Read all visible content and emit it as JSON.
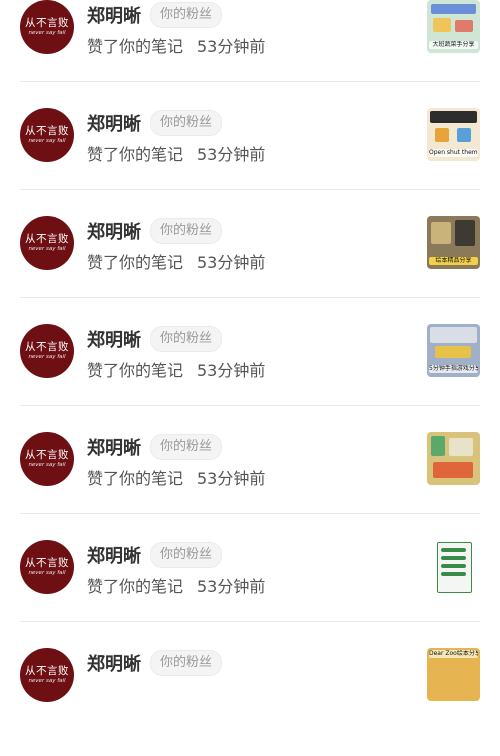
{
  "notifications": [
    {
      "avatar_line1": "从不言败",
      "avatar_line2": "never say fail",
      "name": "郑明晰",
      "badge": "你的粉丝",
      "action": "赞了你的笔记",
      "time": "53分钟前",
      "thumb_caption": "大班蔬菜手分享"
    },
    {
      "avatar_line1": "从不言败",
      "avatar_line2": "never say fail",
      "name": "郑明晰",
      "badge": "你的粉丝",
      "action": "赞了你的笔记",
      "time": "53分钟前",
      "thumb_caption": "Open shut them 绘本游戏分享"
    },
    {
      "avatar_line1": "从不言败",
      "avatar_line2": "never say fail",
      "name": "郑明晰",
      "badge": "你的粉丝",
      "action": "赞了你的笔记",
      "time": "53分钟前",
      "thumb_caption": "绘本精品分享"
    },
    {
      "avatar_line1": "从不言败",
      "avatar_line2": "never say fail",
      "name": "郑明晰",
      "badge": "你的粉丝",
      "action": "赞了你的笔记",
      "time": "53分钟前",
      "thumb_caption": "5分钟手指游戏分享"
    },
    {
      "avatar_line1": "从不言败",
      "avatar_line2": "never say fail",
      "name": "郑明晰",
      "badge": "你的粉丝",
      "action": "赞了你的笔记",
      "time": "53分钟前",
      "thumb_caption": ""
    },
    {
      "avatar_line1": "从不言败",
      "avatar_line2": "never say fail",
      "name": "郑明晰",
      "badge": "你的粉丝",
      "action": "赞了你的笔记",
      "time": "53分钟前",
      "thumb_caption": ""
    },
    {
      "avatar_line1": "从不言败",
      "avatar_line2": "never say fail",
      "name": "郑明晰",
      "badge": "你的粉丝",
      "action": "",
      "time": "",
      "thumb_caption": "Dear Zoo绘本分享"
    }
  ],
  "colors": {
    "avatar_bg": "#6e0f14",
    "divider": "#e9e9e9",
    "badge_bg": "#f4f4f4"
  }
}
